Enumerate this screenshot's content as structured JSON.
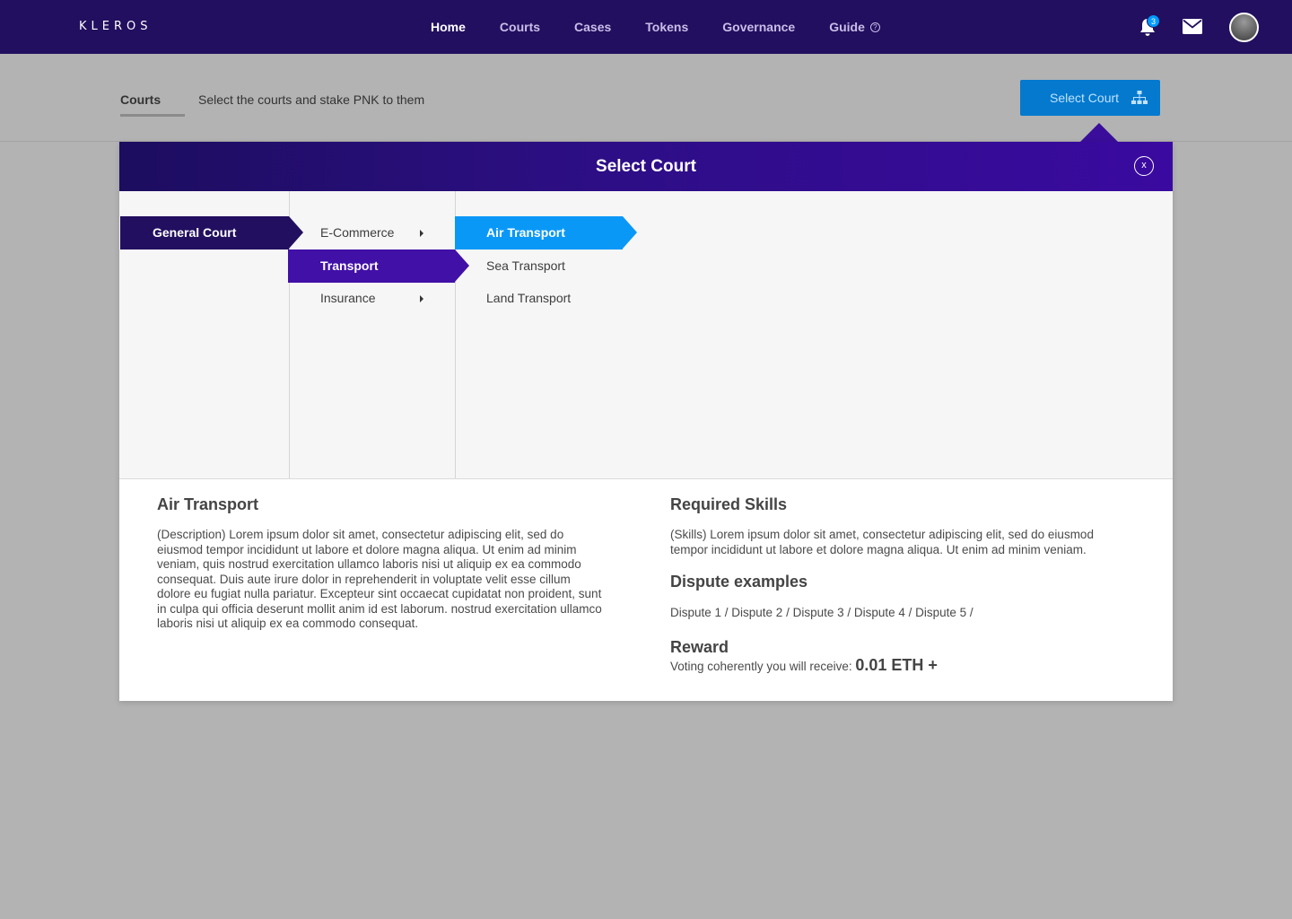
{
  "app": {
    "logo": "KLEROS"
  },
  "nav": {
    "links": [
      "Home",
      "Courts",
      "Cases",
      "Tokens",
      "Governance",
      "Guide"
    ],
    "active": "Home",
    "guide_help": "?",
    "notifications_count": "3"
  },
  "subheader": {
    "tab": "Courts",
    "description": "Select the courts and stake PNK to them",
    "select_button": "Select Court"
  },
  "modal": {
    "title": "Select Court",
    "close_label": "x",
    "columns": [
      {
        "items": [
          {
            "label": "General Court",
            "selected": true
          }
        ]
      },
      {
        "items": [
          {
            "label": "E-Commerce",
            "has_children": true
          },
          {
            "label": "Transport",
            "selected": true
          },
          {
            "label": "Insurance",
            "has_children": true
          }
        ]
      },
      {
        "items": [
          {
            "label": "Air Transport",
            "selected": true
          },
          {
            "label": "Sea Transport"
          },
          {
            "label": "Land Transport"
          }
        ]
      }
    ],
    "details": {
      "title": "Air Transport",
      "description": "(Description) Lorem ipsum dolor sit amet, consectetur adipiscing elit, sed do eiusmod tempor incididunt ut labore et dolore magna aliqua. Ut enim ad minim veniam, quis nostrud exercitation ullamco laboris nisi ut aliquip ex ea commodo consequat. Duis aute irure dolor in reprehenderit in voluptate velit esse cillum dolore eu fugiat nulla pariatur. Excepteur sint occaecat cupidatat non proident, sunt in culpa qui officia deserunt mollit anim id est laborum. nostrud exercitation ullamco laboris nisi ut aliquip ex ea commodo consequat.",
      "skills_title": "Required Skills",
      "skills": "(Skills) Lorem ipsum dolor sit amet, consectetur adipiscing elit, sed do eiusmod tempor incididunt ut labore et dolore magna aliqua. Ut enim ad minim veniam.",
      "disputes_title": "Dispute examples",
      "disputes": "Dispute 1 / Dispute 2 / Dispute 3 / Dispute 4 / Dispute 5 /",
      "reward_title": "Reward",
      "reward_text": "Voting coherently you will receive: ",
      "reward_value": "0.01 ETH +"
    }
  },
  "colors": {
    "nav_bg": "#220f5f",
    "accent_blue": "#0a98f7",
    "accent_purple": "#4110a7",
    "button_blue": "#0479ce"
  }
}
